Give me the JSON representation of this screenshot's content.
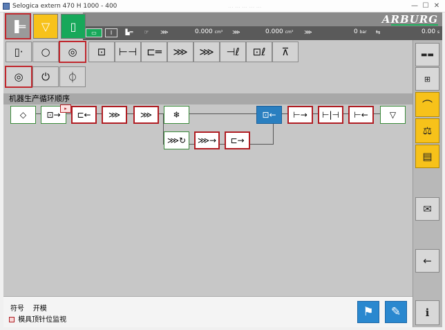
{
  "window": {
    "title": "Selogica extern  470 H  1000 - 400",
    "faded_text": "... ...  ...  ...  ...",
    "minimize": "—",
    "maximize": "☐",
    "close": "✕"
  },
  "brand": "ARBURG",
  "status": {
    "mode_label": "I",
    "value1": "0.000",
    "unit1": "cm³",
    "value2": "0.000",
    "unit2": "cm³",
    "value3": "0",
    "unit3": "bar",
    "value4": "0.00",
    "unit4": "s"
  },
  "section_title": "机器生产循环顺序",
  "legend": {
    "symbol_label": "符号",
    "symbol_value": "开模",
    "monitor_label": "模具顶针位监视"
  },
  "colors": {
    "accent_yellow": "#f7c21a",
    "accent_green": "#17a85a",
    "accent_blue": "#2a7fc0",
    "highlight_red": "#c0272d"
  }
}
